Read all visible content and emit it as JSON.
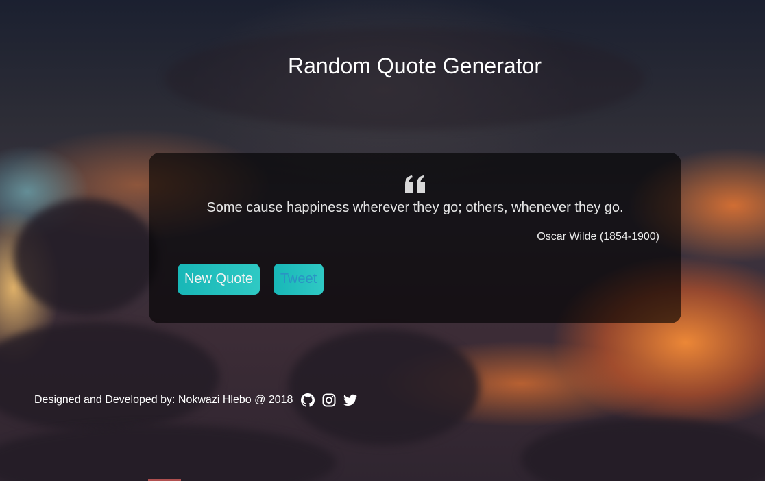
{
  "page": {
    "title": "Random Quote Generator"
  },
  "quote": {
    "icon": "quote-left-icon",
    "text": "Some cause happiness wherever they go; others, whenever they go.",
    "author": "Oscar Wilde (1854-1900)"
  },
  "buttons": {
    "new_quote_label": "New Quote",
    "tweet_label": "Tweet"
  },
  "footer": {
    "credit_text": "Designed and Developed by: Nokwazi Hlebo @ 2018",
    "social_icons": [
      "github-icon",
      "instagram-icon",
      "twitter-icon"
    ]
  },
  "colors": {
    "button_bg": "#1fbfbc",
    "new_quote_text": "#f4f4f4",
    "tweet_text": "#2a93c4",
    "card_bg": "rgba(0,0,0,0.62)"
  }
}
